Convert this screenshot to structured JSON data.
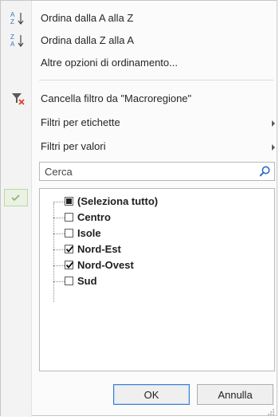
{
  "menu": {
    "sort_asc": {
      "icon": "sort-a-to-z-icon",
      "text": "Ordina dalla A alla Z"
    },
    "sort_desc": {
      "icon": "sort-z-to-a-icon",
      "text": "Ordina dalla Z alla A"
    },
    "sort_more": {
      "text": "Altre opzioni di ordinamento..."
    },
    "clear_filter": {
      "icon": "clear-filter-icon",
      "text": "Cancella filtro da \"Macroregione\""
    },
    "label_filters": {
      "text": "Filtri per etichette",
      "icon": "submenu-arrow-icon"
    },
    "value_filters": {
      "text": "Filtri per valori",
      "icon": "submenu-arrow-icon"
    }
  },
  "search": {
    "placeholder": "Cerca",
    "value": "",
    "icon": "search-icon"
  },
  "filter_list": {
    "items": [
      {
        "label": "(Seleziona tutto)",
        "state": "partial"
      },
      {
        "label": "Centro",
        "state": "unchecked"
      },
      {
        "label": "Isole",
        "state": "unchecked"
      },
      {
        "label": "Nord-Est",
        "state": "checked"
      },
      {
        "label": "Nord-Ovest",
        "state": "checked"
      },
      {
        "label": "Sud",
        "state": "unchecked"
      }
    ]
  },
  "buttons": {
    "ok": "OK",
    "cancel": "Annulla"
  },
  "colors": {
    "accent_border": "#3c7fd1",
    "check_green": "#8bb56b"
  }
}
